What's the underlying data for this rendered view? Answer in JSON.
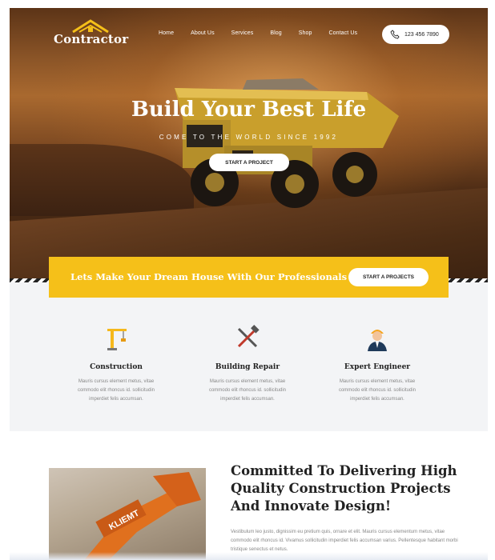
{
  "brand": {
    "logo_text": "Contractor"
  },
  "nav": {
    "items": [
      "Home",
      "About Us",
      "Services",
      "Blog",
      "Shop",
      "Contact Us"
    ],
    "phone": "123 456 7890"
  },
  "hero": {
    "title": "Build Your Best Life",
    "subtitle": "COME TO THE WORLD SINCE 1992",
    "cta": "START A PROJECT"
  },
  "banner": {
    "text": "Lets Make Your Dream House With Our Professionals",
    "cta": "START A PROJECTS"
  },
  "services": [
    {
      "icon": "crane-icon",
      "title": "Construction",
      "desc": "Mauris cursus element metus, vitae commodo elit rhoncus id. sollicitudin imperdiet felis accumsan."
    },
    {
      "icon": "hammer-wrench-icon",
      "title": "Building Repair",
      "desc": "Mauris cursus element metus, vitae commodo elit rhoncus id. sollicitudin imperdiet felis accumsan."
    },
    {
      "icon": "engineer-icon",
      "title": "Expert Engineer",
      "desc": "Mauris cursus element metus, vitae commodo elit rhoncus id. sollicitudin imperdiet felis accumsan."
    }
  ],
  "about": {
    "title": "Committed To Delivering High Quality Construction Projects And Innovate Design!",
    "text": "Vestibulum leo justo, dignissim eu pretium quis, ornare et elit. Mauris cursus elementum metus, vitae commodo elit rhoncus id. Vivamus sollicitudin imperdiet felis accumsan varius. Pellentesque habitant morbi tristique senectus et netus.",
    "image_label": "KLIEMT"
  },
  "colors": {
    "accent": "#f5c019",
    "dark": "#222222",
    "light_bg": "#f3f4f6"
  }
}
